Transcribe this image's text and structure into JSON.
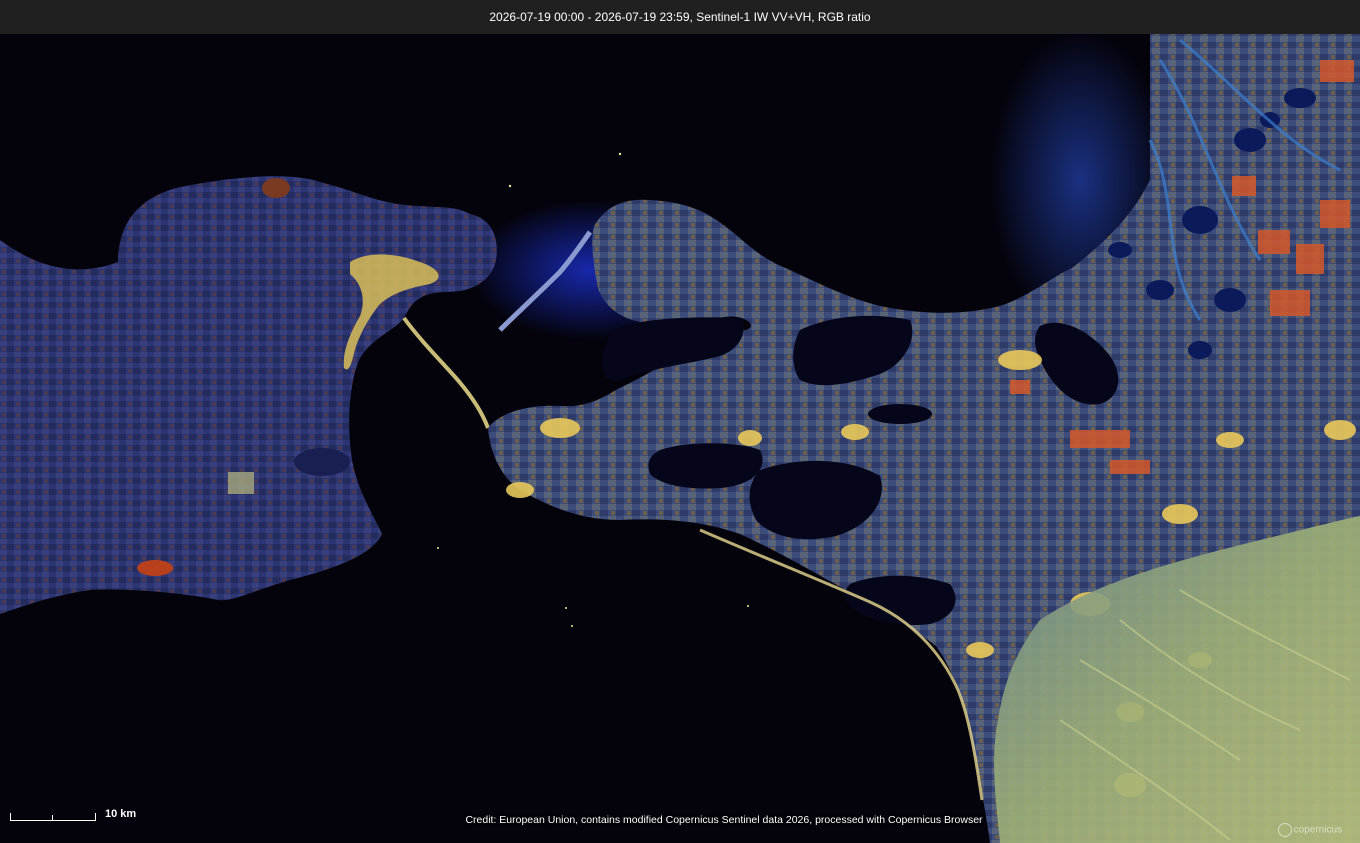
{
  "header": {
    "title": "2026-07-19 00:00 - 2026-07-19 23:59, Sentinel-1 IW VV+VH, RGB ratio"
  },
  "scale": {
    "label": "10 km"
  },
  "credit": {
    "text": "Credit: European Union, contains modified Copernicus Sentinel data 2026, processed with Copernicus Browser"
  },
  "logo": {
    "text": "copernicus",
    "icon": "copernicus-logo-icon"
  },
  "colors": {
    "water": "#04030c",
    "land_blue": "#2b3470",
    "urban_yellow": "#e8c85a",
    "field_orange": "#d4582a",
    "hills_green": "#8fa46a"
  }
}
